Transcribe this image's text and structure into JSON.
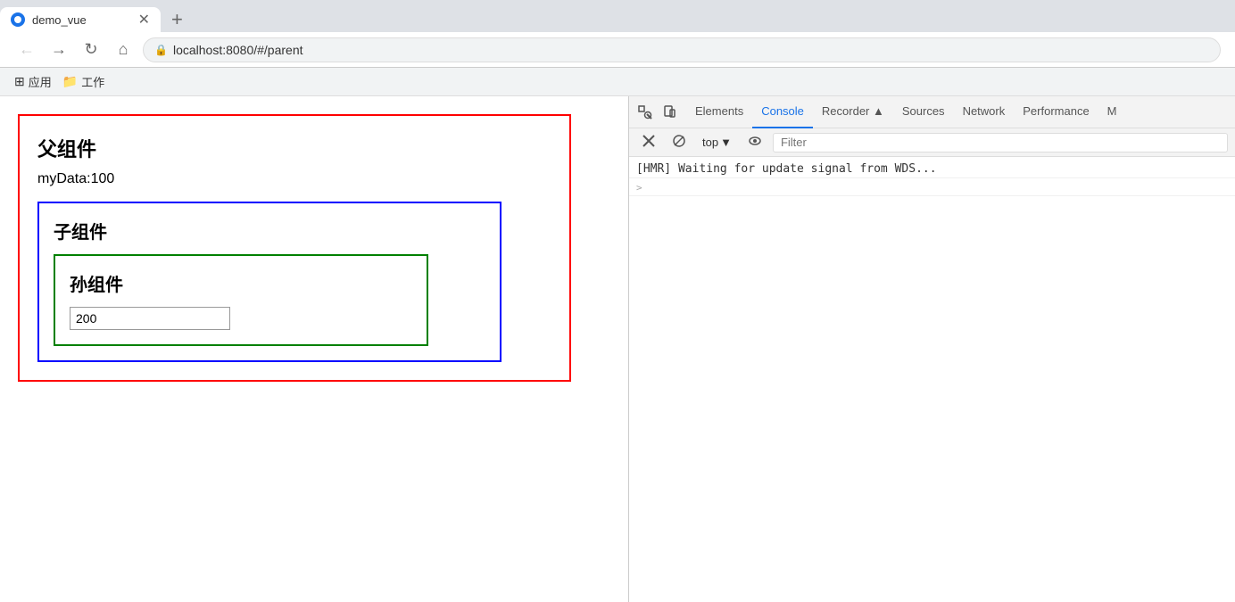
{
  "browser": {
    "tab_title": "demo_vue",
    "tab_new_label": "+",
    "nav_back": "←",
    "nav_forward": "→",
    "nav_refresh": "↻",
    "nav_home": "⌂",
    "url": "localhost:8080/#/parent",
    "bookmarks": [
      {
        "icon": "⊞",
        "label": "应用"
      },
      {
        "icon": "📁",
        "label": "工作"
      }
    ]
  },
  "web": {
    "parent_title": "父组件",
    "parent_data": "myData:100",
    "child_title": "子组件",
    "grandchild_title": "孙组件",
    "grandchild_input_value": "200"
  },
  "devtools": {
    "tabs": [
      {
        "label": "Elements",
        "active": false
      },
      {
        "label": "Console",
        "active": true
      },
      {
        "label": "Recorder ▲",
        "active": false
      },
      {
        "label": "Sources",
        "active": false
      },
      {
        "label": "Network",
        "active": false
      },
      {
        "label": "Performance",
        "active": false
      },
      {
        "label": "M",
        "active": false
      }
    ],
    "toolbar": {
      "top_label": "top",
      "filter_placeholder": "Filter"
    },
    "console_lines": [
      {
        "text": "[HMR] Waiting for update signal from WDS..."
      }
    ],
    "expand_symbol": ">"
  }
}
